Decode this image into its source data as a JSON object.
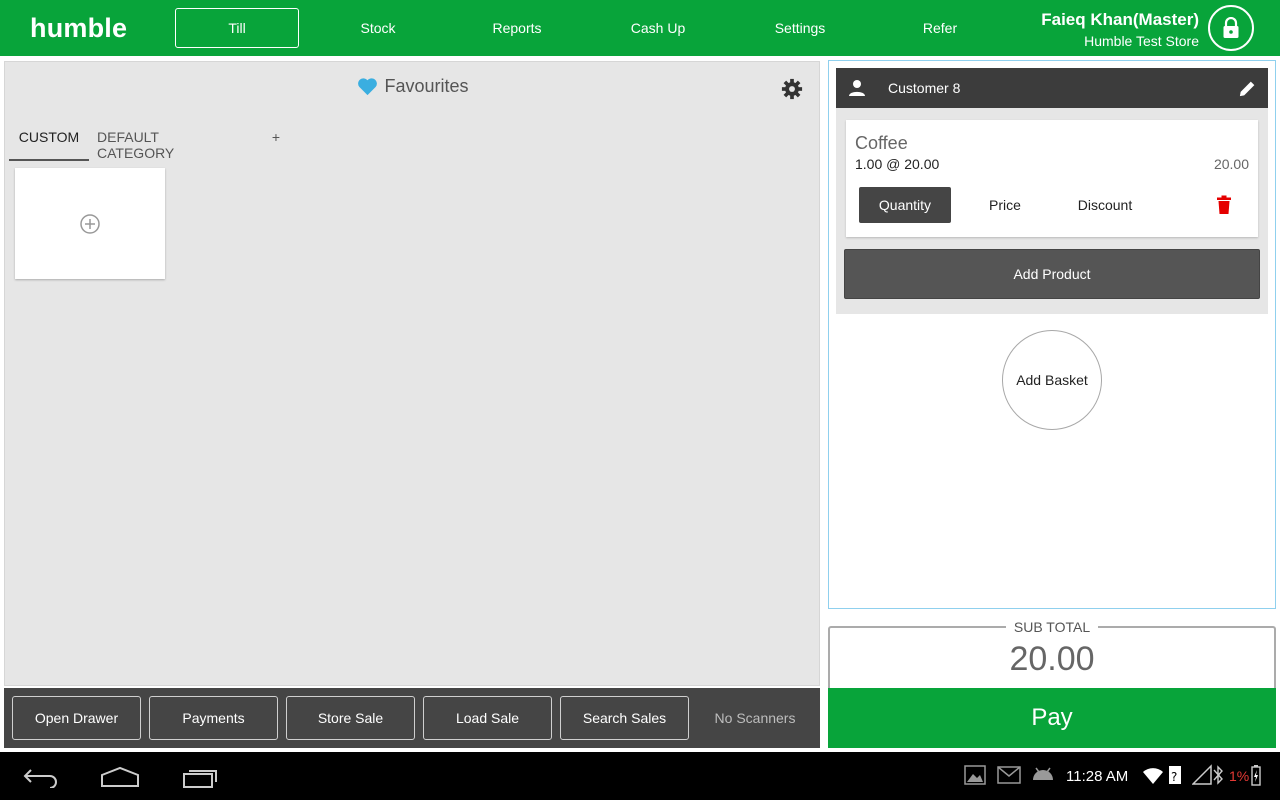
{
  "app": {
    "logo": "humble",
    "brand_color": "#08a43a",
    "accent_blue": "#3aaee0",
    "danger_color": "#e50000"
  },
  "nav": {
    "items": [
      {
        "label": "Till",
        "active": true
      },
      {
        "label": "Stock",
        "active": false
      },
      {
        "label": "Reports",
        "active": false
      },
      {
        "label": "Cash Up",
        "active": false
      },
      {
        "label": "Settings",
        "active": false
      },
      {
        "label": "Refer",
        "active": false
      }
    ]
  },
  "user": {
    "name": "Faieq Khan(Master)",
    "store": "Humble Test Store",
    "lock_icon": "lock-icon"
  },
  "favourites": {
    "title": "Favourites",
    "title_icon": "heart-icon",
    "settings_icon": "gear-icon",
    "tabs": [
      {
        "label": "CUSTOM",
        "active": true
      },
      {
        "label": "DEFAULT CATEGORY",
        "active": false
      },
      {
        "label": "+",
        "active": false
      }
    ],
    "add_tile_icon": "plus-circle-icon"
  },
  "toolbar": {
    "buttons": [
      "Open Drawer",
      "Payments",
      "Store Sale",
      "Load Sale",
      "Search Sales"
    ],
    "scanner_status": "No Scanners"
  },
  "basket": {
    "customer": "Customer 8",
    "customer_icon": "person-icon",
    "edit_icon": "pencil-icon",
    "line": {
      "product": "Coffee",
      "qty_price": "1.00 @ 20.00",
      "total": "20.00",
      "tabs": [
        {
          "label": "Quantity",
          "active": true
        },
        {
          "label": "Price",
          "active": false
        },
        {
          "label": "Discount",
          "active": false
        }
      ],
      "delete_icon": "trash-icon"
    },
    "add_product_label": "Add Product",
    "add_basket_label": "Add Basket"
  },
  "totals": {
    "subtotal_label": "SUB TOTAL",
    "subtotal_value": "20.00",
    "pay_label": "Pay"
  },
  "system_bar": {
    "clock": "11:28 AM",
    "battery": "1%"
  }
}
